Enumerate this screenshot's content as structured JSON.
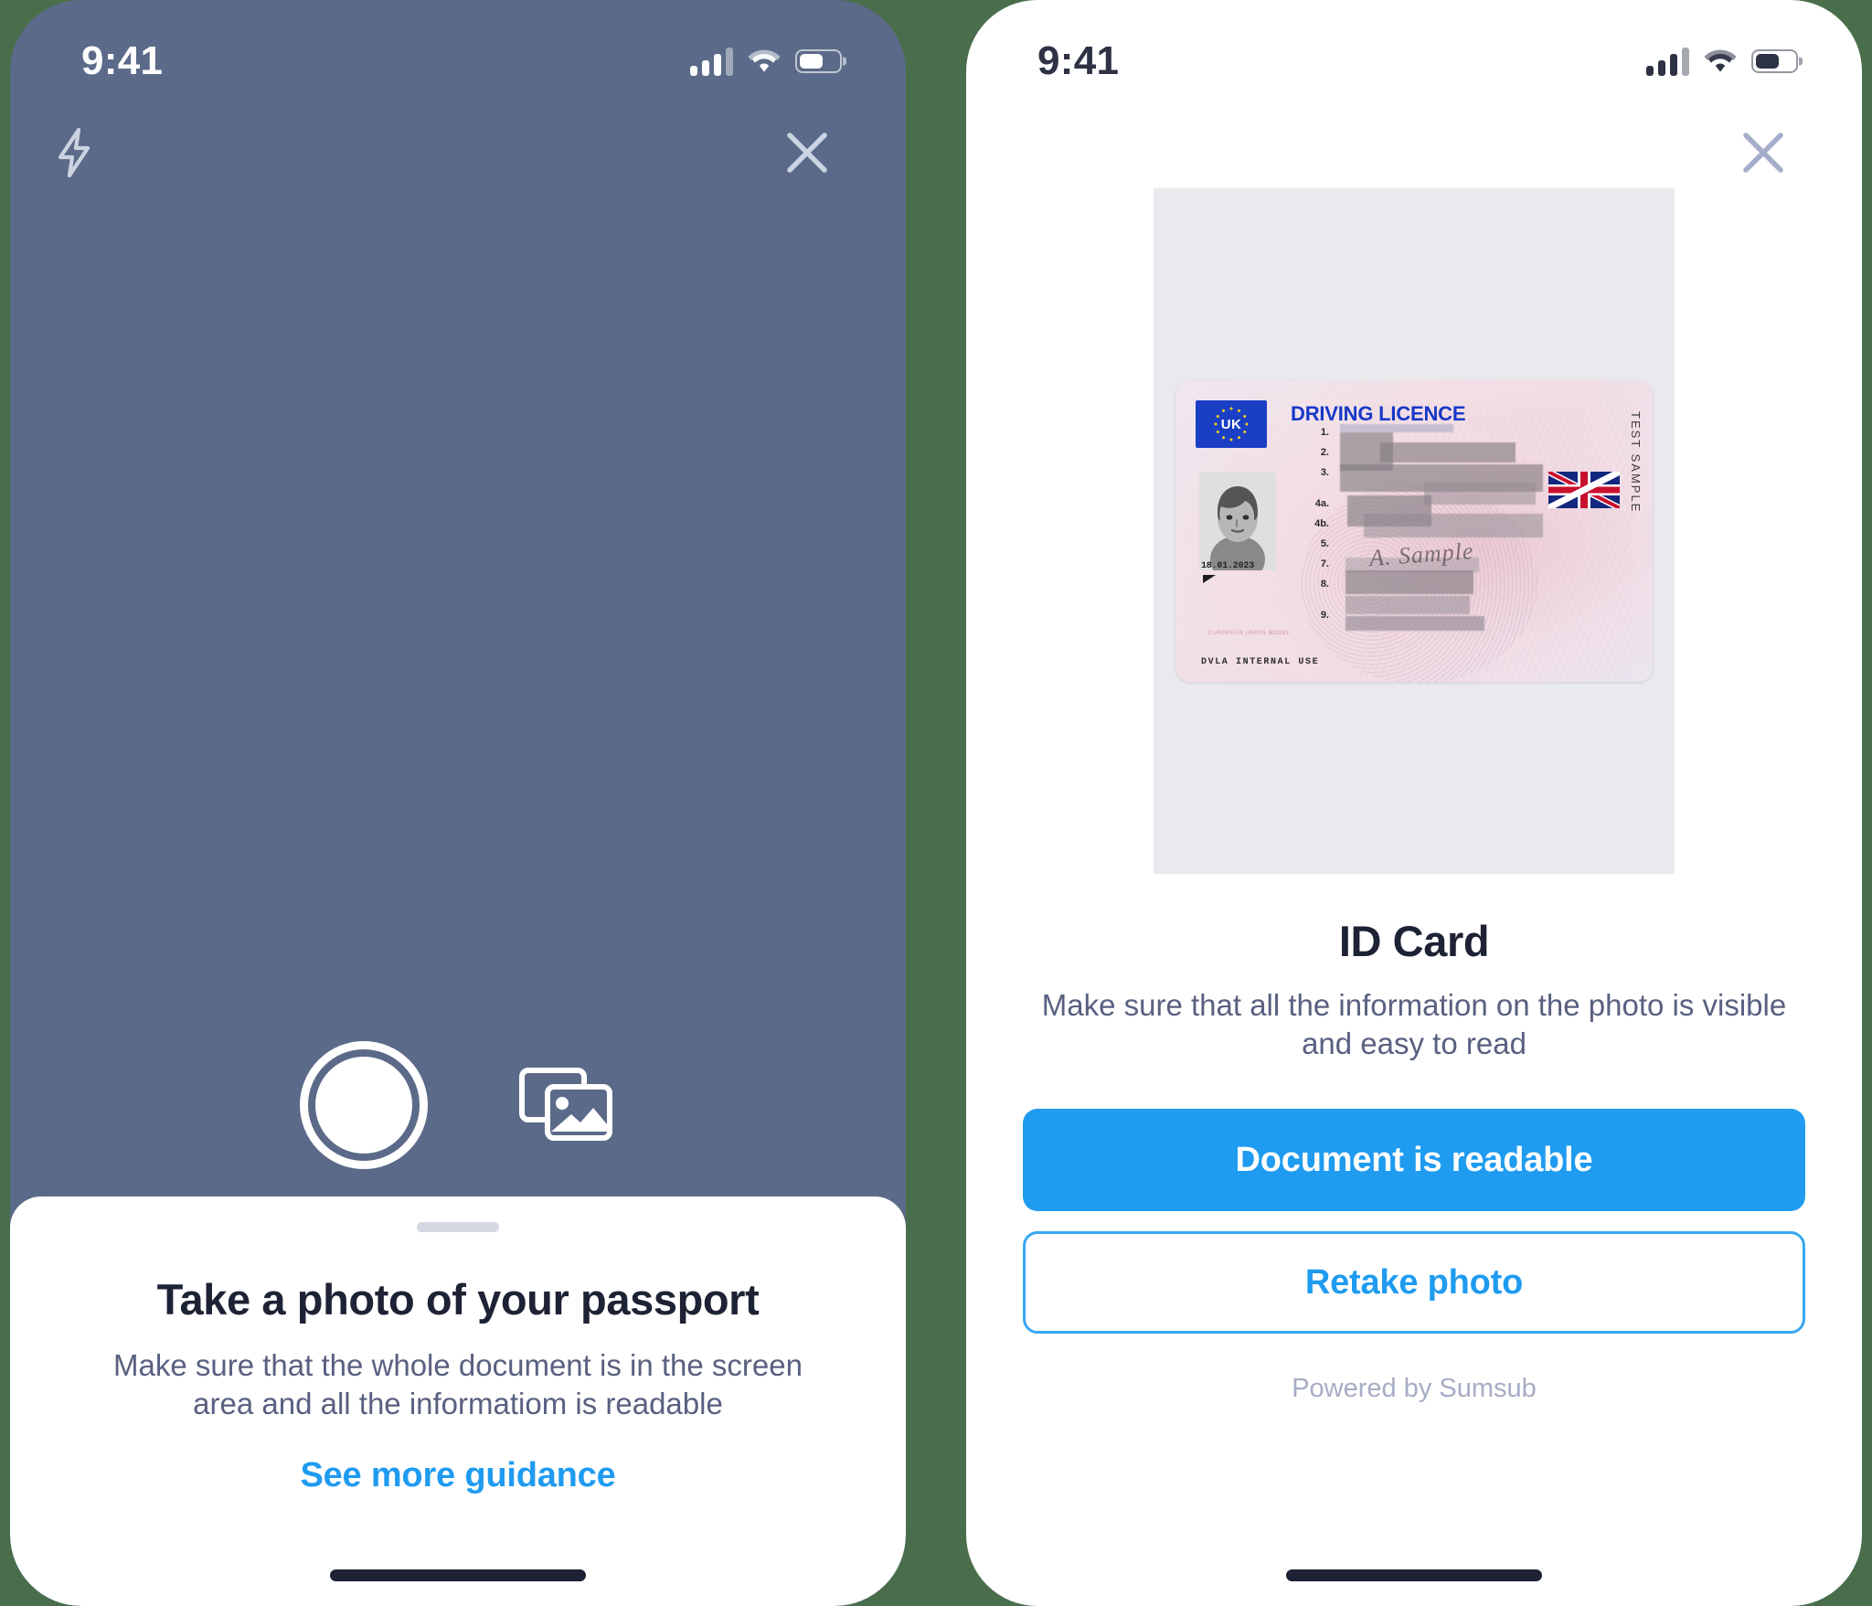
{
  "background_color": "#4a6e4c",
  "accent_color": "#1f9bf0",
  "camera_screen": {
    "status_bar": {
      "time": "9:41",
      "cellular_icon": "cellular-bars-icon",
      "wifi_icon": "wifi-icon",
      "battery_icon": "battery-icon",
      "battery_level": "61%"
    },
    "top_bar": {
      "flash_icon": "flash-icon",
      "close_icon": "close-icon"
    },
    "controls": {
      "shutter_label": "shutter-button",
      "gallery_icon": "gallery-icon"
    },
    "sheet": {
      "title": "Take a photo of your passport",
      "subtitle": "Make sure that the whole document is in the screen area and all the informatiom is readable",
      "link": "See more guidance",
      "grabber": "drag-handle"
    },
    "viewfinder_color": "#5b6a88"
  },
  "review_screen": {
    "status_bar": {
      "time": "9:41",
      "cellular_icon": "cellular-bars-icon",
      "wifi_icon": "wifi-icon",
      "battery_icon": "battery-icon",
      "battery_level": "61%"
    },
    "top_bar": {
      "close_icon": "close-icon"
    },
    "document_preview": {
      "backdrop_color": "#e9e9ee",
      "licence": {
        "header": "DRIVING LICENCE",
        "country_badge": "UK",
        "field_numbers": [
          "1.",
          "2.",
          "3.",
          "4a.",
          "4b.",
          "5.",
          "7.",
          "8.",
          "9."
        ],
        "signature": "A. Sample",
        "issue_date": "18.01.2023",
        "vertical_watermark": "TEST SAMPLE",
        "footer": "DVLA INTERNAL USE",
        "microtext": "EUROPEAN UNION MODEL",
        "flag_icon": "union-jack-icon",
        "portrait_icon": "portrait-photo-icon"
      }
    },
    "title": "ID Card",
    "subtitle": "Make sure that all the information on the photo is visible and easy to read",
    "primary_button": "Document is readable",
    "secondary_button": "Retake photo",
    "footer": "Powered by Sumsub"
  }
}
